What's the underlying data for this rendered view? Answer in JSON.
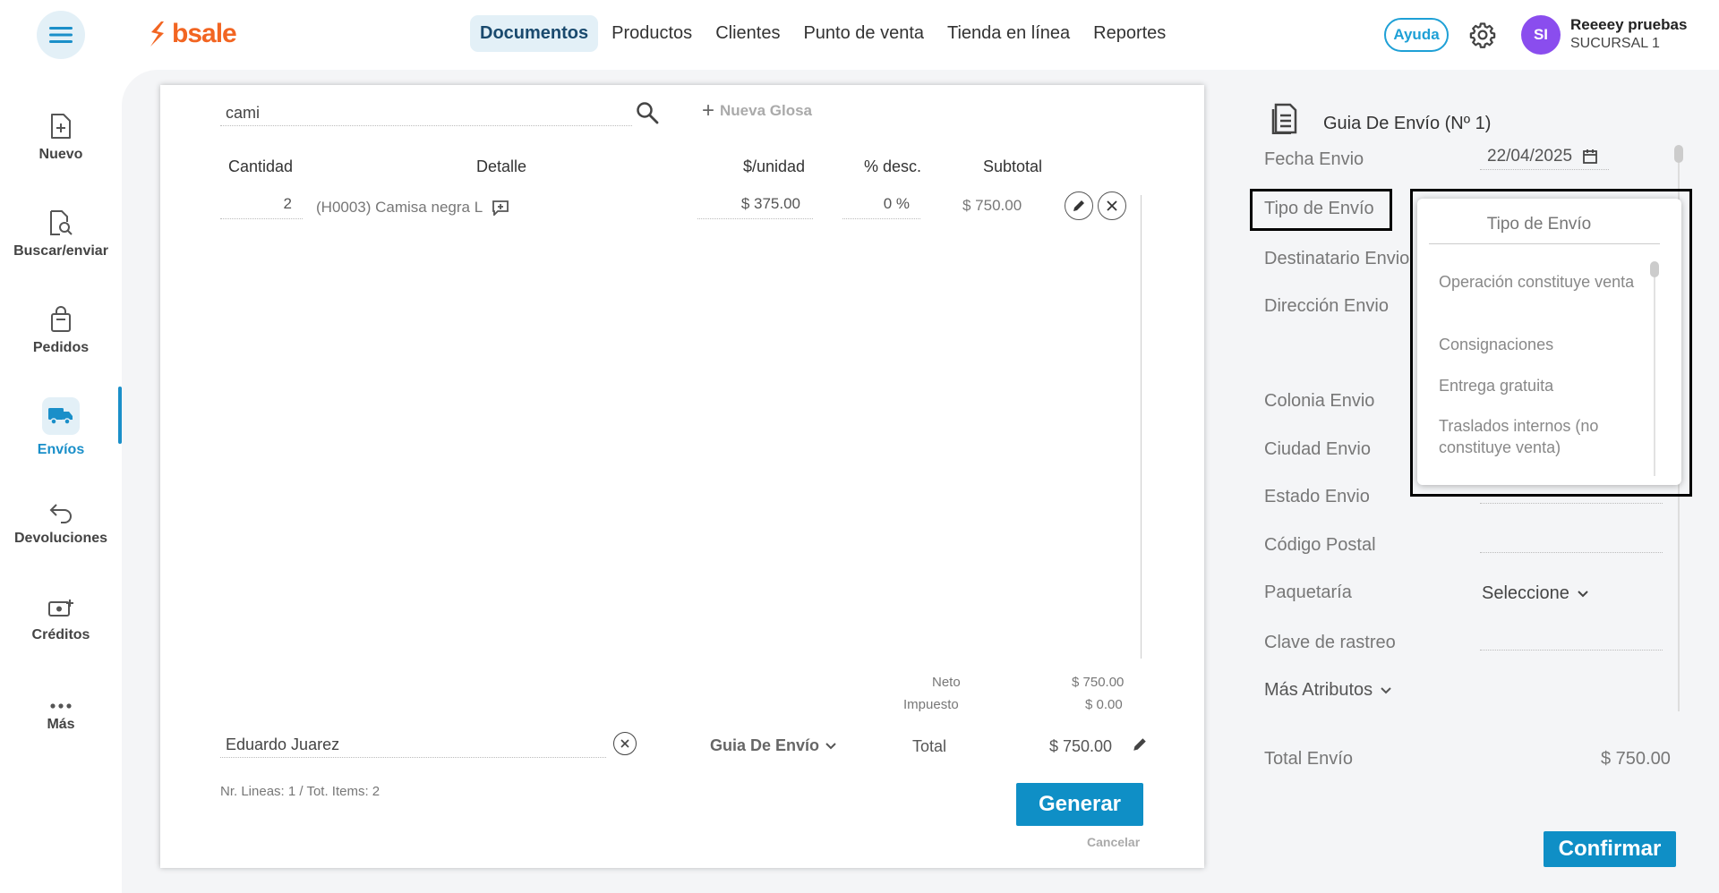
{
  "header": {
    "logo_text": "bsale",
    "nav": [
      "Documentos",
      "Productos",
      "Clientes",
      "Punto de venta",
      "Tienda en línea",
      "Reportes"
    ],
    "help": "Ayuda",
    "avatar": "SI",
    "user_name": "Reeeey pruebas",
    "branch": "SUCURSAL 1"
  },
  "sidebar": [
    {
      "label": "Nuevo",
      "icon": "new-document-icon"
    },
    {
      "label": "Buscar/enviar",
      "icon": "search-document-icon"
    },
    {
      "label": "Pedidos",
      "icon": "shopping-bag-icon"
    },
    {
      "label": "Envíos",
      "icon": "truck-icon"
    },
    {
      "label": "Devoluciones",
      "icon": "return-arrow-icon"
    },
    {
      "label": "Créditos",
      "icon": "money-plus-icon"
    },
    {
      "label": "Más",
      "icon": "more-dots-icon"
    }
  ],
  "search": {
    "value": "cami",
    "nueva_glosa": "Nueva Glosa"
  },
  "table": {
    "headers": [
      "Cantidad",
      "Detalle",
      "$/unidad",
      "% desc.",
      "Subtotal"
    ],
    "rows": [
      {
        "qty": "2",
        "detail": "(H0003) Camisa negra L",
        "unit": "$ 375.00",
        "disc": "0 %",
        "subtotal": "$ 750.00"
      }
    ]
  },
  "totals": {
    "neto_label": "Neto",
    "neto": "$ 750.00",
    "impuesto_label": "Impuesto",
    "impuesto": "$ 0.00",
    "total_label": "Total",
    "total": "$ 750.00"
  },
  "client": {
    "name": "Eduardo Juarez"
  },
  "doc_type": "Guia De Envío",
  "summary": "Nr. Lineas: 1 / Tot. Items: 2",
  "generate": "Generar",
  "cancel": "Cancelar",
  "panel": {
    "title": "Guia De Envío (Nº 1)",
    "fecha_label": "Fecha Envio",
    "fecha": "22/04/2025",
    "tipo_label": "Tipo de Envío",
    "destinatario_label": "Destinatario Envio",
    "direccion_label": "Dirección Envio",
    "colonia_label": "Colonia Envio",
    "ciudad_label": "Ciudad Envio",
    "estado_label": "Estado Envio",
    "cp_label": "Código Postal",
    "paqueteria_label": "Paquetaría",
    "paqueteria_value": "Seleccione",
    "clave_label": "Clave de rastreo",
    "mas_atributos": "Más Atributos",
    "total_label": "Total Envío",
    "total": "$ 750.00",
    "confirm": "Confirmar"
  },
  "dropdown": {
    "title": "Tipo de Envío",
    "options": [
      "Operación constituye venta",
      "Consignaciones",
      "Entrega gratuita",
      "Traslados internos (no constituye venta)"
    ]
  },
  "colors": {
    "accent": "#0f8fc6",
    "brand": "#f26522",
    "avatar": "#8a4dee"
  }
}
